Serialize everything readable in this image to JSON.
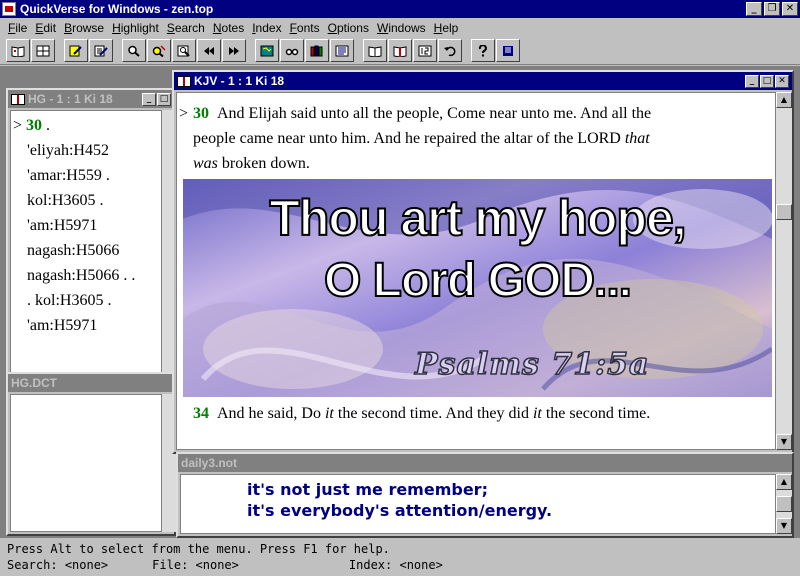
{
  "app": {
    "title": "QuickVerse for Windows - zen.top",
    "window_buttons": [
      "_",
      "❐",
      "✕"
    ]
  },
  "menu": [
    {
      "label": "File",
      "u": "F",
      "rest": "ile"
    },
    {
      "label": "Edit",
      "u": "E",
      "rest": "dit"
    },
    {
      "label": "Browse",
      "u": "B",
      "rest": "rowse"
    },
    {
      "label": "Highlight",
      "u": "H",
      "rest": "ighlight"
    },
    {
      "label": "Search",
      "u": "S",
      "rest": "earch"
    },
    {
      "label": "Notes",
      "u": "N",
      "rest": "otes"
    },
    {
      "label": "Index",
      "u": "I",
      "rest": "ndex"
    },
    {
      "label": "Fonts",
      "u": "F",
      "rest": "onts"
    },
    {
      "label": "Options",
      "u": "O",
      "rest": "ptions"
    },
    {
      "label": "Windows",
      "u": "W",
      "rest": "indows"
    },
    {
      "label": "Help",
      "u": "H",
      "rest": "elp"
    }
  ],
  "toolbar": {
    "buttons": [
      "open-book",
      "parallel",
      "edit-note",
      "edit-list",
      "search",
      "search-again",
      "search-results",
      "back",
      "forward",
      "map",
      "glasses",
      "books",
      "list",
      "read-book",
      "open-bible",
      "chapter",
      "undo",
      "help",
      "bookmark"
    ],
    "colors": {
      "icon_blue": "#000080",
      "icon_yellow": "#ffff00",
      "icon_red": "#c00000",
      "icon_green": "#008080"
    }
  },
  "hg_window": {
    "title": "HG - 1 : 1 Ki 18",
    "marker": ">",
    "verse_num": "30",
    "verse_dot": " .",
    "lines": [
      "'eliyah:H452",
      "'amar:H559 .",
      "kol:H3605 .",
      "'am:H5971",
      "nagash:H5066",
      "nagash:H5066 . .",
      ". kol:H3605 .",
      "'am:H5971"
    ]
  },
  "hgdct_window": {
    "title": "HG.DCT"
  },
  "kjv_window": {
    "title": "KJV - 1 : 1 Ki 18",
    "verse30": {
      "marker": ">",
      "num": "30",
      "line1": "And Elijah said unto all the people, Come near unto me. And all the",
      "line2_a": "people came near unto him. And he repaired the altar of the LORD ",
      "line2_i": "that",
      "line3_i": "was",
      "line3_b": " broken down."
    },
    "banner": {
      "line1": "Thou art my hope,",
      "line2": "O Lord GOD...",
      "reference": "Psalms 71:5a"
    },
    "verse34": {
      "num": "34",
      "a": "And he said, Do ",
      "i1": "it",
      "b": " the second time. And they did ",
      "i2": "it",
      "c": " the second time."
    }
  },
  "notes_window": {
    "title": "daily3.not",
    "lines": [
      "it's not just me remember;",
      "it's everybody's attention/energy."
    ]
  },
  "status": {
    "help": "Press Alt to select from the menu.  Press F1 for help.",
    "search_label": "Search:",
    "search_value": "<none>",
    "file_label": "File:",
    "file_value": "<none>",
    "index_label": "Index:",
    "index_value": "<none>"
  }
}
